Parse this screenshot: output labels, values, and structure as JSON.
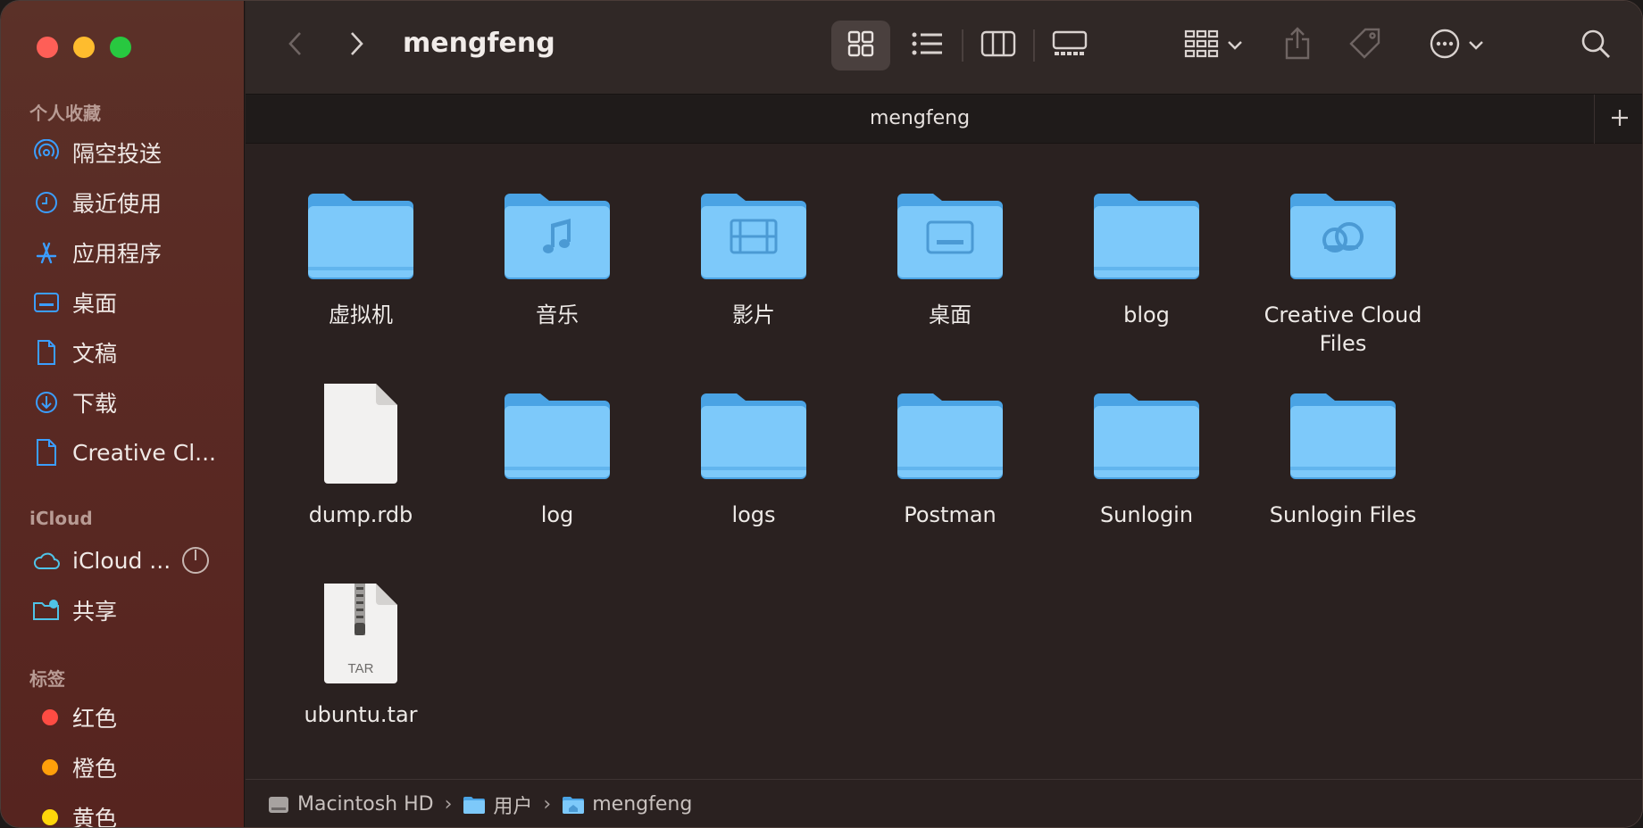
{
  "window": {
    "title": "mengfeng",
    "tab_title": "mengfeng"
  },
  "sidebar": {
    "favorites_header": "个人收藏",
    "favorites": [
      {
        "label": "隔空投送",
        "icon": "airdrop-icon"
      },
      {
        "label": "最近使用",
        "icon": "clock-icon"
      },
      {
        "label": "应用程序",
        "icon": "applications-icon"
      },
      {
        "label": "桌面",
        "icon": "desktop-icon"
      },
      {
        "label": "文稿",
        "icon": "document-icon"
      },
      {
        "label": "下载",
        "icon": "download-icon"
      },
      {
        "label": "Creative Cl...",
        "icon": "file-icon"
      }
    ],
    "icloud_header": "iCloud",
    "icloud": [
      {
        "label": "iCloud ...",
        "icon": "cloud-icon"
      },
      {
        "label": "共享",
        "icon": "shared-folder-icon"
      }
    ],
    "tags_header": "标签",
    "tags": [
      {
        "label": "红色",
        "color": "#fe4c43"
      },
      {
        "label": "橙色",
        "color": "#ff9f0a"
      },
      {
        "label": "黄色",
        "color": "#ffd60a"
      }
    ]
  },
  "files": [
    {
      "name": "虚拟机",
      "type": "folder"
    },
    {
      "name": "音乐",
      "type": "music-folder"
    },
    {
      "name": "影片",
      "type": "movies-folder"
    },
    {
      "name": "桌面",
      "type": "desktop-folder"
    },
    {
      "name": "blog",
      "type": "folder"
    },
    {
      "name": "Creative Cloud Files",
      "type": "creative-cloud-folder"
    },
    {
      "name": "dump.rdb",
      "type": "document"
    },
    {
      "name": "log",
      "type": "folder"
    },
    {
      "name": "logs",
      "type": "folder"
    },
    {
      "name": "Postman",
      "type": "folder"
    },
    {
      "name": "Sunlogin",
      "type": "folder"
    },
    {
      "name": "Sunlogin Files",
      "type": "folder"
    },
    {
      "name": "ubuntu.tar",
      "type": "archive",
      "badge": "TAR"
    }
  ],
  "pathbar": {
    "items": [
      {
        "label": "Macintosh HD",
        "icon": "hard-drive-icon"
      },
      {
        "label": "用户",
        "icon": "folder-icon"
      },
      {
        "label": "mengfeng",
        "icon": "home-folder-icon"
      }
    ],
    "separator": "›"
  },
  "colors": {
    "accent": "#3b9eff",
    "folder": "#6ec1f4",
    "sidebar_bg": "#5a2a24",
    "content_bg": "#2a2120"
  }
}
